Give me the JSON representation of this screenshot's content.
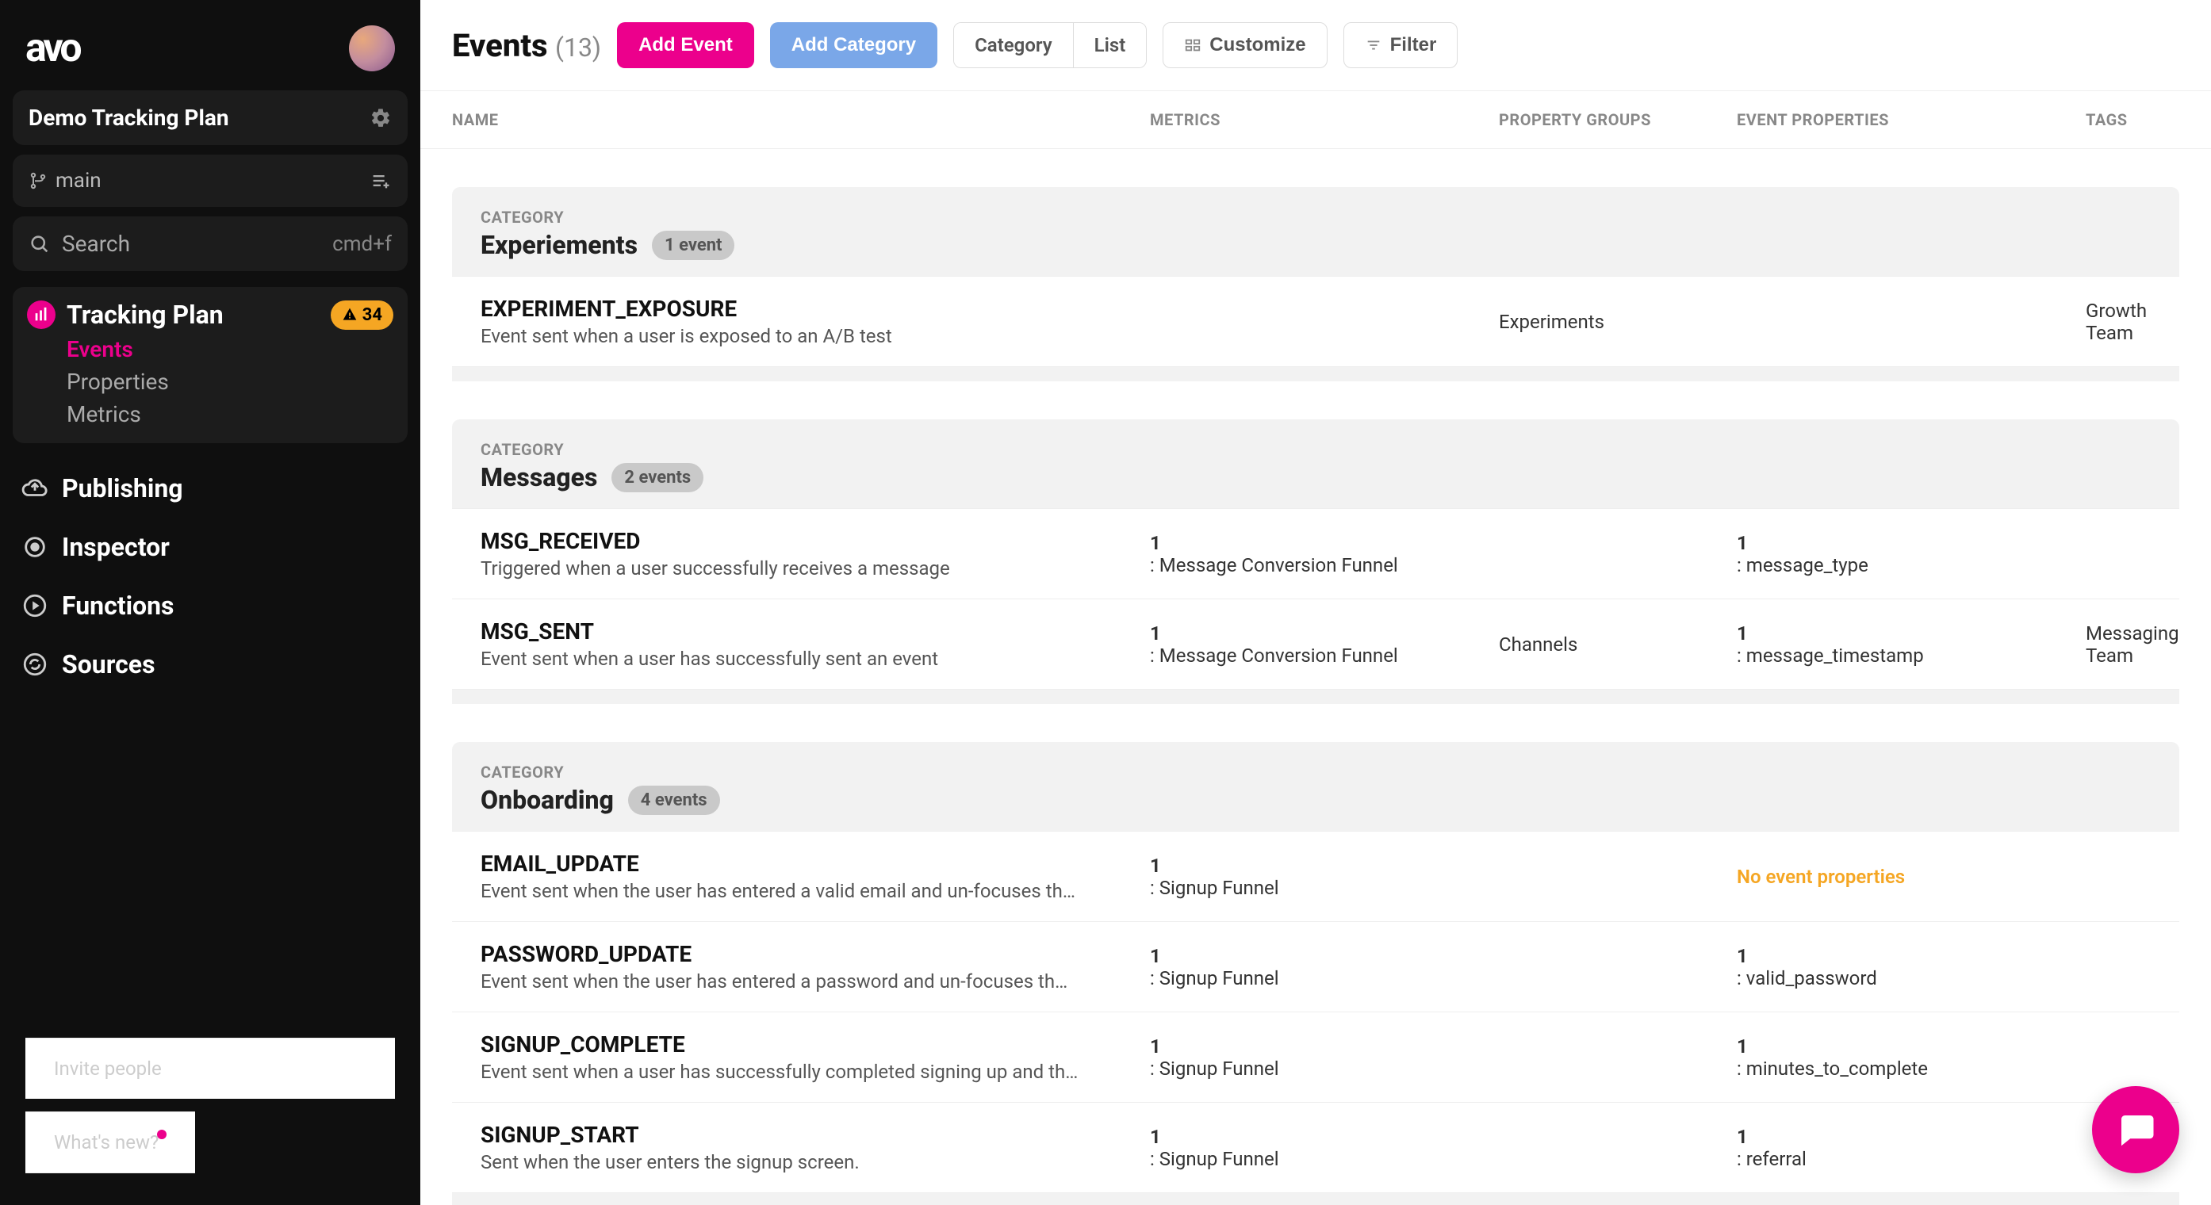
{
  "sidebar": {
    "logo": "avo",
    "plan_title": "Demo Tracking Plan",
    "branch_name": "main",
    "search_placeholder": "Search",
    "search_shortcut": "cmd+f",
    "tracking_plan": {
      "title": "Tracking Plan",
      "badge": "34",
      "items": [
        "Events",
        "Properties",
        "Metrics"
      ],
      "active": "Events"
    },
    "nav": [
      {
        "label": "Publishing",
        "icon": "cloud-upload-icon"
      },
      {
        "label": "Inspector",
        "icon": "target-icon"
      },
      {
        "label": "Functions",
        "icon": "play-circle-icon"
      },
      {
        "label": "Sources",
        "icon": "sync-icon"
      }
    ],
    "footer": {
      "invite": "Invite people",
      "whatsnew": "What's new?"
    }
  },
  "topbar": {
    "title": "Events",
    "count": "(13)",
    "add_event": "Add Event",
    "add_category": "Add Category",
    "view_category": "Category",
    "view_list": "List",
    "customize": "Customize",
    "filter": "Filter"
  },
  "columns": {
    "name": "NAME",
    "metrics": "METRICS",
    "property_groups": "PROPERTY GROUPS",
    "event_properties": "EVENT PROPERTIES",
    "tags": "TAGS"
  },
  "category_label": "CATEGORY",
  "no_props": "No event properties",
  "categories": [
    {
      "name": "Experiements",
      "badge": "1 event",
      "events": [
        {
          "name": "EXPERIMENT_EXPOSURE",
          "desc": "Event sent when a user is exposed to an A/B test",
          "metrics": "",
          "property_groups": "Experiments",
          "event_properties": "",
          "tags": "Growth Team"
        }
      ]
    },
    {
      "name": "Messages",
      "badge": "2 events",
      "events": [
        {
          "name": "MSG_RECEIVED",
          "desc": "Triggered when a user successfully receives a message",
          "metrics": "1: Message Conversion Funnel",
          "property_groups": "",
          "event_properties": "1: message_type",
          "tags": ""
        },
        {
          "name": "MSG_SENT",
          "desc": "Event sent when a user has successfully sent an event",
          "metrics": "1: Message Conversion Funnel",
          "property_groups": "Channels",
          "event_properties": "1: message_timestamp",
          "tags": "Messaging Team"
        }
      ]
    },
    {
      "name": "Onboarding",
      "badge": "4 events",
      "events": [
        {
          "name": "EMAIL_UPDATE",
          "desc": "Event sent when the user has entered a valid email and un-focuses th…",
          "metrics": "1: Signup Funnel",
          "property_groups": "",
          "event_properties": "__NO_PROPS__",
          "tags": ""
        },
        {
          "name": "PASSWORD_UPDATE",
          "desc": "Event sent when the user has entered a password and un-focuses th…",
          "metrics": "1: Signup Funnel",
          "property_groups": "",
          "event_properties": "1: valid_password",
          "tags": ""
        },
        {
          "name": "SIGNUP_COMPLETE",
          "desc": "Event sent when a user has successfully completed signing up and th…",
          "metrics": "1: Signup Funnel",
          "property_groups": "",
          "event_properties": "1: minutes_to_complete",
          "tags": ""
        },
        {
          "name": "SIGNUP_START",
          "desc": "Sent when the user enters the signup screen.",
          "metrics": "1: Signup Funnel",
          "property_groups": "",
          "event_properties": "1: referral",
          "tags": ""
        }
      ]
    }
  ]
}
